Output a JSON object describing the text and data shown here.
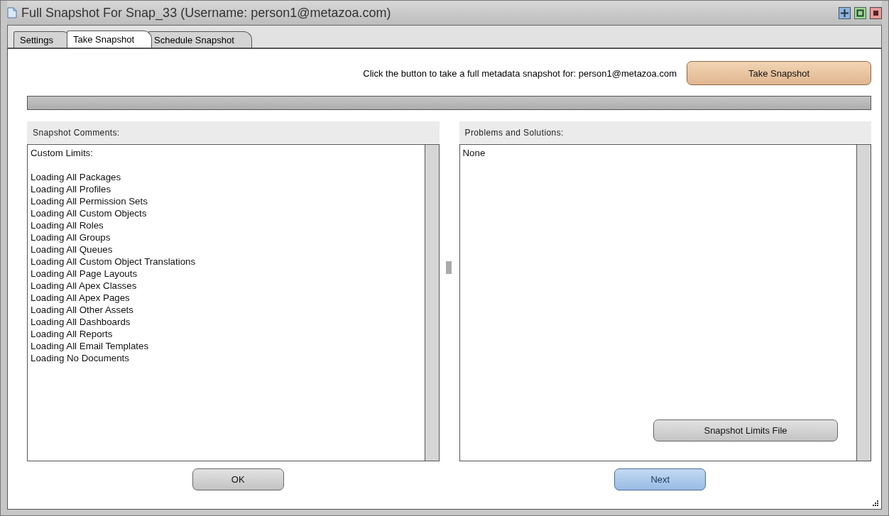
{
  "window": {
    "title": "Full Snapshot For Snap_33 (Username: person1@metazoa.com)"
  },
  "tabs": [
    {
      "label": "Settings",
      "selected": false
    },
    {
      "label": "Take Snapshot",
      "selected": true
    },
    {
      "label": "Schedule Snapshot",
      "selected": false
    }
  ],
  "prompt": "Click the button to take a full metadata snapshot for: person1@metazoa.com",
  "take_button": "Take Snapshot",
  "comments": {
    "title": "Snapshot Comments:",
    "heading": "Custom Limits:",
    "lines": [
      "Loading All Packages",
      "Loading All Profiles",
      "Loading All Permission Sets",
      "Loading All Custom Objects",
      "Loading All Roles",
      "Loading All Groups",
      "Loading All Queues",
      "Loading All Custom Object Translations",
      "Loading All Page Layouts",
      "Loading All Apex Classes",
      "Loading All Apex Pages",
      "Loading All Other Assets",
      "Loading All Dashboards",
      "Loading All Reports",
      "Loading All Email Templates",
      "Loading No Documents"
    ]
  },
  "progress": {
    "level": 0
  },
  "problems": {
    "title": "Problems and Solutions:",
    "text": "None",
    "button": "Snapshot Limits File"
  },
  "buttons": [
    {
      "label": "OK",
      "kind": "plain"
    },
    {
      "label": "Next",
      "kind": "primary"
    }
  ]
}
